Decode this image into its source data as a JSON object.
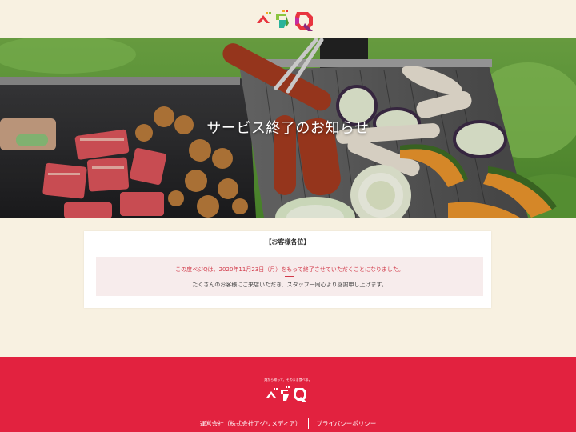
{
  "header": {
    "logo_alt": "ベジQ"
  },
  "hero": {
    "title": "サービス終了のお知らせ"
  },
  "notice": {
    "heading": "【お客様各位】",
    "message": "この度ベジQは、2020年11月23日（月）をもって終了させていただくことになりました。",
    "thanks": "たくさんのお客様にご来店いただき、スタッフ一同心より感謝申し上げます。"
  },
  "footer": {
    "tagline": "畑から帰って、そのまま食べる。",
    "logo_text": "ベジQ",
    "links": [
      {
        "label": "運営会社（株式会社アグリメディア）"
      },
      {
        "label": "プライバシーポリシー"
      }
    ]
  },
  "colors": {
    "background": "#f8f1e1",
    "footer": "#e2223f",
    "accent_red": "#d23a4a",
    "notice_box": "#f7ecec"
  }
}
